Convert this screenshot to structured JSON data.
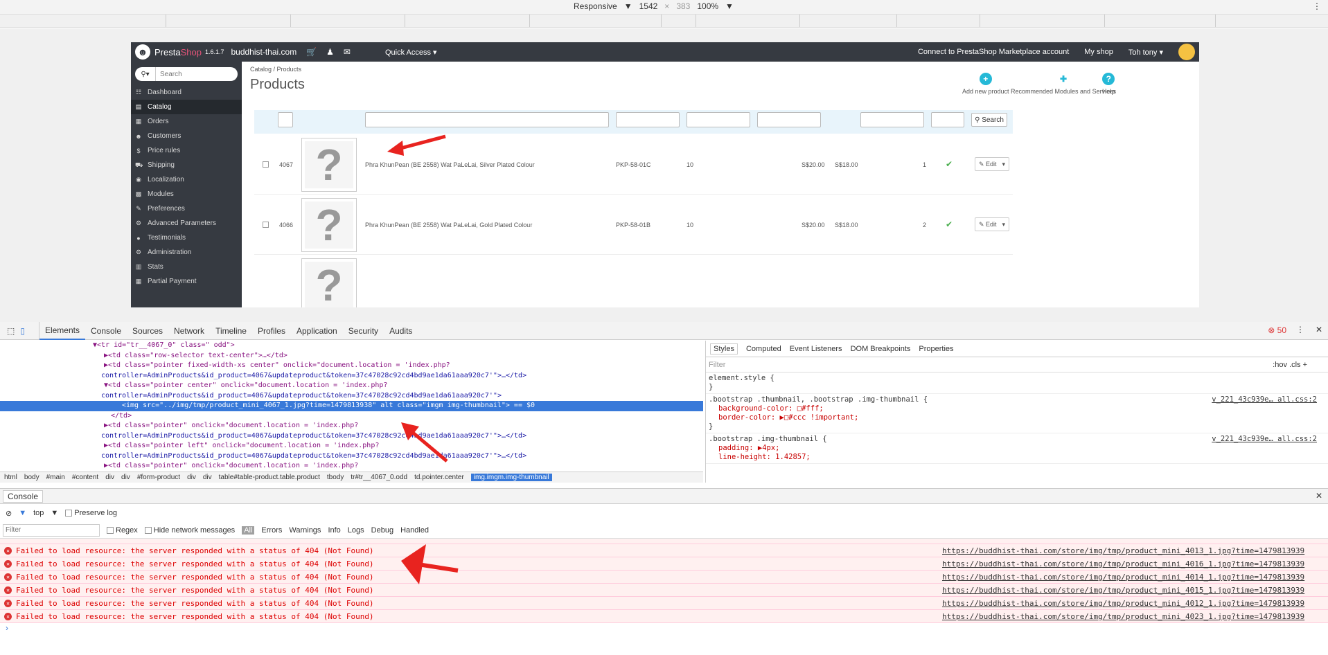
{
  "devtools_toolbar": {
    "device": "Responsive",
    "width": "1542",
    "times": "×",
    "height": "383",
    "zoom": "100%",
    "kebab": "⋮"
  },
  "ps": {
    "brand_presta": "Presta",
    "brand_shop": "Shop",
    "version": "1.6.1.7",
    "domain": "buddhist-thai.com",
    "quick_access": "Quick Access ▾",
    "marketplace": "Connect to PrestaShop Marketplace account",
    "my_shop": "My shop",
    "user": "Toh tony ▾",
    "search_placeholder": "Search",
    "breadcrumb": "Catalog  /  Products",
    "title": "Products",
    "add_new": "Add new product",
    "recommended": "Recommended Modules and Services",
    "help": "Help",
    "search_btn": "Search",
    "edit": "Edit",
    "sidebar": [
      {
        "icon": "☷",
        "label": "Dashboard"
      },
      {
        "icon": "▤",
        "label": "Catalog"
      },
      {
        "icon": "▦",
        "label": "Orders"
      },
      {
        "icon": "☻",
        "label": "Customers"
      },
      {
        "icon": "$",
        "label": "Price rules"
      },
      {
        "icon": "⛟",
        "label": "Shipping"
      },
      {
        "icon": "◉",
        "label": "Localization"
      },
      {
        "icon": "▩",
        "label": "Modules"
      },
      {
        "icon": "✎",
        "label": "Preferences"
      },
      {
        "icon": "⚙",
        "label": "Advanced Parameters"
      },
      {
        "icon": "●",
        "label": "Testimonials"
      },
      {
        "icon": "⚙",
        "label": "Administration"
      },
      {
        "icon": "▥",
        "label": "Stats"
      },
      {
        "icon": "▦",
        "label": "Partial Payment"
      }
    ],
    "rows": [
      {
        "id": "4067",
        "name": "Phra KhunPean (BE 2558) Wat PaLeLai, Silver Plated Colour",
        "ref": "PKP-58-01C",
        "cat": "10",
        "base": "S$20.00",
        "final": "S$18.00",
        "qty": "1"
      },
      {
        "id": "4066",
        "name": "Phra KhunPean (BE 2558) Wat PaLeLai, Gold Plated Colour",
        "ref": "PKP-58-01B",
        "cat": "10",
        "base": "S$20.00",
        "final": "S$18.00",
        "qty": "2"
      }
    ]
  },
  "tabs": [
    "Elements",
    "Console",
    "Sources",
    "Network",
    "Timeline",
    "Profiles",
    "Application",
    "Security",
    "Audits"
  ],
  "error_count": "50",
  "elements_dom": {
    "l1_tag": "▼<tr id=\"tr__4067_0\" class=\" odd\">",
    "l2": "▶<td class=\"row-selector text-center\">…</td>",
    "l3": "▶<td class=\"pointer fixed-width-xs center\" onclick=\"document.location = 'index.php?",
    "l4": "controller=AdminProducts&id_product=4067&updateproduct&token=37c47028c92cd4bd9ae1da61aaa920c7'\">…</td>",
    "l5": "▼<td class=\"pointer center\" onclick=\"document.location = 'index.php?",
    "l6": "controller=AdminProducts&id_product=4067&updateproduct&token=37c47028c92cd4bd9ae1da61aaa920c7'\">",
    "l7": "<img src=\"../img/tmp/product_mini_4067_1.jpg?time=1479813938\" alt class=\"imgm img-thumbnail\"> == $0",
    "l8": "</td>",
    "l9": "▶<td class=\"pointer\" onclick=\"document.location = 'index.php?",
    "l10": "controller=AdminProducts&id_product=4067&updateproduct&token=37c47028c92cd4bd9ae1da61aaa920c7'\">…</td>",
    "l11": "▶<td class=\"pointer left\" onclick=\"document.location = 'index.php?",
    "l12": "controller=AdminProducts&id_product=4067&updateproduct&token=37c47028c92cd4bd9ae1da61aaa920c7'\">…</td>",
    "l13": "▶<td class=\"pointer\" onclick=\"document.location = 'index.php?"
  },
  "dom_breadcrumb": [
    "html",
    "body",
    "#main",
    "#content",
    "div",
    "div",
    "#form-product",
    "div",
    "div",
    "table#table-product.table.product",
    "tbody",
    "tr#tr__4067_0.odd",
    "td.pointer.center",
    "img.imgm.img-thumbnail"
  ],
  "styles": {
    "tabs": [
      "Styles",
      "Computed",
      "Event Listeners",
      "DOM Breakpoints",
      "Properties"
    ],
    "filter": "Filter",
    "hov": ":hov  .cls  +",
    "r1": "element.style {",
    "r1b": "}",
    "r2sel": ".bootstrap .thumbnail, .bootstrap .img-thumbnail {",
    "r2p1": "background-color: □#fff;",
    "r2p2": "border-color: ▶□#ccc !important;",
    "r2src": "v_221_43c939e… all.css:2",
    "r3sel": ".bootstrap .img-thumbnail {",
    "r3p1": "padding: ▶4px;",
    "r3p2": "line-height: 1.42857;",
    "r3src": "v_221_43c939e… all.css:2"
  },
  "console": {
    "title": "Console",
    "context": "top",
    "preserve": "Preserve log",
    "filter_ph": "Filter",
    "regex": "Regex",
    "hide_net": "Hide network messages",
    "levels": [
      "All",
      "Errors",
      "Warnings",
      "Info",
      "Logs",
      "Debug",
      "Handled"
    ],
    "message": "Failed to load resource: the server responded with a status of 404 (Not Found)",
    "urls": [
      "https://buddhist-thai.com/store/img/tmp/product_mini_4013_1.jpg?time=1479813939",
      "https://buddhist-thai.com/store/img/tmp/product_mini_4016_1.jpg?time=1479813939",
      "https://buddhist-thai.com/store/img/tmp/product_mini_4014_1.jpg?time=1479813939",
      "https://buddhist-thai.com/store/img/tmp/product_mini_4015_1.jpg?time=1479813939",
      "https://buddhist-thai.com/store/img/tmp/product_mini_4012_1.jpg?time=1479813939",
      "https://buddhist-thai.com/store/img/tmp/product_mini_4023_1.jpg?time=1479813939"
    ]
  },
  "colors": {
    "accent": "#3879d9",
    "ps_dark": "#363a41",
    "error_red": "#d33333",
    "arrow": "#e8231f"
  }
}
